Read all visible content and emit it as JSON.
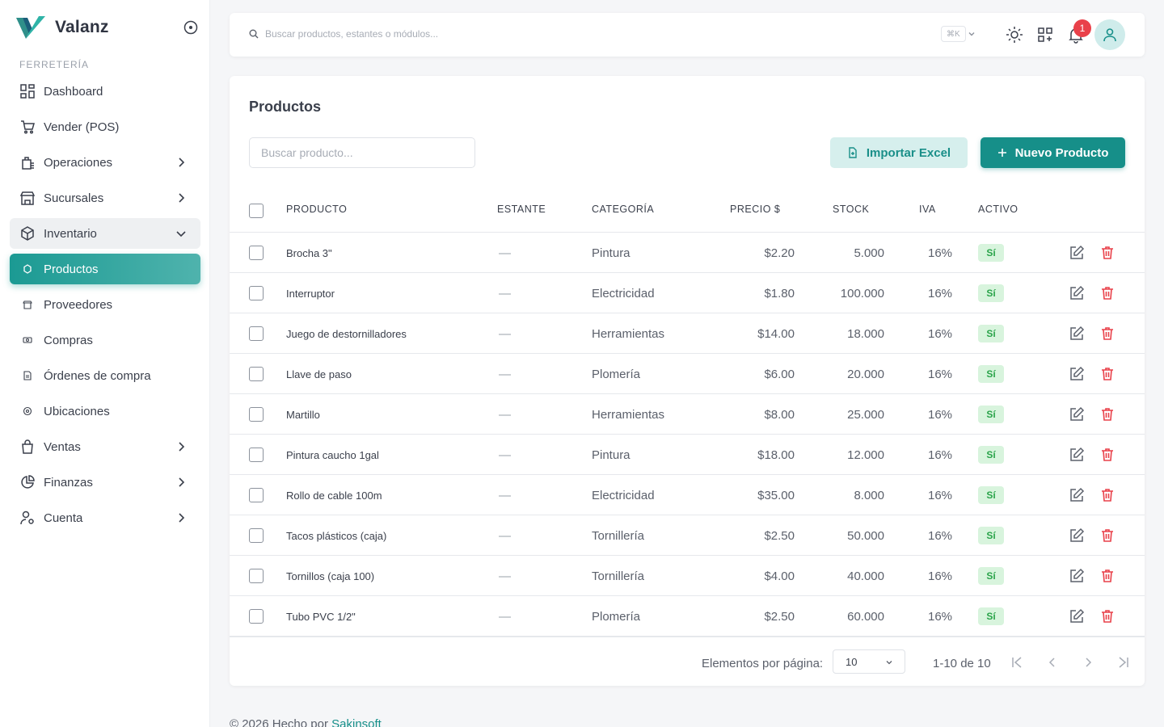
{
  "brand": {
    "name": "Valanz"
  },
  "sidebar": {
    "section": "FERRETERÍA",
    "items": [
      {
        "label": "Dashboard",
        "icon": "dashboard-icon"
      },
      {
        "label": "Vender (POS)",
        "icon": "cart-icon"
      },
      {
        "label": "Operaciones",
        "icon": "operations-icon"
      },
      {
        "label": "Sucursales",
        "icon": "store-icon"
      },
      {
        "label": "Inventario",
        "icon": "box-icon"
      },
      {
        "label": "Productos",
        "icon": "dot-icon"
      },
      {
        "label": "Proveedores",
        "icon": "dot-icon"
      },
      {
        "label": "Compras",
        "icon": "dot-icon"
      },
      {
        "label": "Órdenes de compra",
        "icon": "dot-icon"
      },
      {
        "label": "Ubicaciones",
        "icon": "dot-icon"
      },
      {
        "label": "Ventas",
        "icon": "bag-icon"
      },
      {
        "label": "Finanzas",
        "icon": "pie-icon"
      },
      {
        "label": "Cuenta",
        "icon": "user-gear-icon"
      }
    ]
  },
  "topbar": {
    "search_placeholder": "Buscar productos, estantes o módulos...",
    "shortcut": "⌘K",
    "notifications": "1"
  },
  "main": {
    "title": "Productos",
    "search_placeholder": "Buscar producto...",
    "import_label": "Importar Excel",
    "new_label": "Nuevo Producto",
    "columns": [
      "PRODUCTO",
      "ESTANTE",
      "CATEGORÍA",
      "PRECIO $",
      "STOCK",
      "IVA",
      "ACTIVO"
    ],
    "rows": [
      {
        "producto": "Brocha 3\"",
        "estante": "—",
        "categoria": "Pintura",
        "precio": "$2.20",
        "stock": "5.000",
        "iva": "16%",
        "activo": "Sí"
      },
      {
        "producto": "Interruptor",
        "estante": "—",
        "categoria": "Electricidad",
        "precio": "$1.80",
        "stock": "100.000",
        "iva": "16%",
        "activo": "Sí"
      },
      {
        "producto": "Juego de destornilladores",
        "estante": "—",
        "categoria": "Herramientas",
        "precio": "$14.00",
        "stock": "18.000",
        "iva": "16%",
        "activo": "Sí"
      },
      {
        "producto": "Llave de paso",
        "estante": "—",
        "categoria": "Plomería",
        "precio": "$6.00",
        "stock": "20.000",
        "iva": "16%",
        "activo": "Sí"
      },
      {
        "producto": "Martillo",
        "estante": "—",
        "categoria": "Herramientas",
        "precio": "$8.00",
        "stock": "25.000",
        "iva": "16%",
        "activo": "Sí"
      },
      {
        "producto": "Pintura caucho 1gal",
        "estante": "—",
        "categoria": "Pintura",
        "precio": "$18.00",
        "stock": "12.000",
        "iva": "16%",
        "activo": "Sí"
      },
      {
        "producto": "Rollo de cable 100m",
        "estante": "—",
        "categoria": "Electricidad",
        "precio": "$35.00",
        "stock": "8.000",
        "iva": "16%",
        "activo": "Sí"
      },
      {
        "producto": "Tacos plásticos (caja)",
        "estante": "—",
        "categoria": "Tornillería",
        "precio": "$2.50",
        "stock": "50.000",
        "iva": "16%",
        "activo": "Sí"
      },
      {
        "producto": "Tornillos (caja 100)",
        "estante": "—",
        "categoria": "Tornillería",
        "precio": "$4.00",
        "stock": "40.000",
        "iva": "16%",
        "activo": "Sí"
      },
      {
        "producto": "Tubo PVC 1/2\"",
        "estante": "—",
        "categoria": "Plomería",
        "precio": "$2.50",
        "stock": "60.000",
        "iva": "16%",
        "activo": "Sí"
      }
    ],
    "pagination": {
      "per_page_label": "Elementos por página:",
      "per_page": "10",
      "range": "1-10 de 10"
    }
  },
  "footer": {
    "text": "© 2026 Hecho por",
    "link": "Sakinsoft"
  },
  "colors": {
    "accent": "#168f89",
    "danger": "#e9414a",
    "success_bg": "#d8f4dd",
    "success_text": "#2aa44a"
  }
}
